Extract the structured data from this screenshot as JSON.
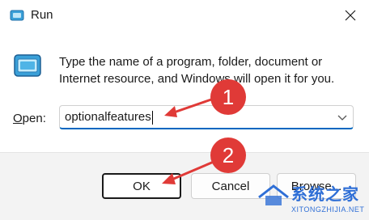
{
  "window": {
    "title": "Run",
    "close_glyph": "✕"
  },
  "icons": {
    "title_icon": "run-icon",
    "app_icon": "run-app-icon",
    "close_icon": "close-icon",
    "dropdown_icon": "chevron-down-icon"
  },
  "body": {
    "description": "Type the name of a program, folder, document or Internet resource, and Windows will open it for you.",
    "open_label_mnemonic": "O",
    "open_label_rest": "pen:",
    "open_value": "optionalfeatures"
  },
  "buttons": {
    "ok": "OK",
    "cancel": "Cancel",
    "browse": "Browse..."
  },
  "annotations": {
    "step1": "1",
    "step2": "2"
  },
  "watermark": {
    "title": "系统之家",
    "url": "XITONGZHIJIA.NET"
  },
  "colors": {
    "accent": "#0067c0",
    "annotation_red": "#e03a37",
    "watermark_blue": "#2f6fd6",
    "footer_bg": "#f3f3f3"
  }
}
